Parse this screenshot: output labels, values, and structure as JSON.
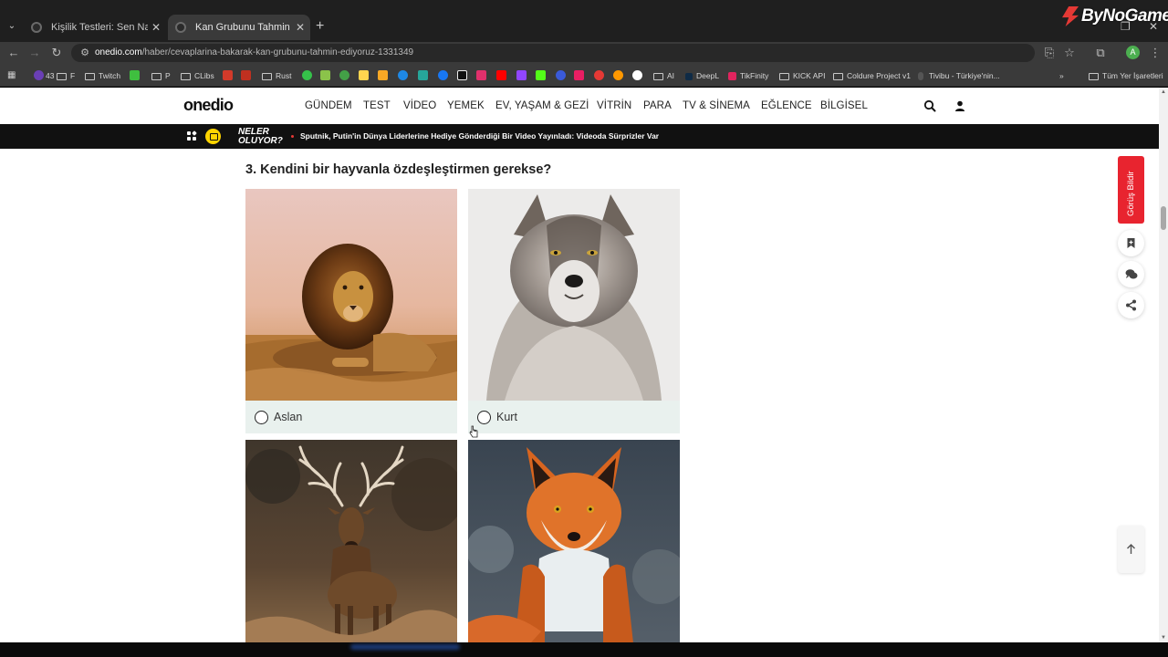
{
  "browser": {
    "tabs": [
      {
        "title": "Kişilik Testleri: Sen Nasıl Birisin?",
        "active": false
      },
      {
        "title": "Kan Grubunu Tahmin Edebilecek",
        "active": true
      }
    ],
    "url_domain": "onedio.com",
    "url_path": "/haber/cevaplarina-bakarak-kan-grubunu-tahmin-ediyoruz-1331349",
    "profile_initial": "A",
    "overlay_brand": "ByNoGame",
    "bookmarks": [
      {
        "label": "43",
        "icon": "badge"
      },
      {
        "label": "F",
        "icon": "folder"
      },
      {
        "label": "Twitch",
        "icon": "folder"
      },
      {
        "label": "P",
        "icon": "folder"
      },
      {
        "label": "CLibs",
        "icon": "folder"
      },
      {
        "label": "Rust",
        "icon": "folder"
      },
      {
        "label": "AI",
        "icon": "folder"
      },
      {
        "label": "DeepL",
        "icon": "deepl"
      },
      {
        "label": "TikFinity",
        "icon": "tikfinity"
      },
      {
        "label": "KICK API",
        "icon": "folder"
      },
      {
        "label": "Coldure Project v1",
        "icon": "folder"
      },
      {
        "label": "Tivibu - Türkiye'nin...",
        "icon": "tivibu"
      },
      {
        "label": "Tüm Yer İşaretleri",
        "icon": "folder"
      }
    ]
  },
  "site": {
    "logo": "onedio",
    "nav": [
      "GÜNDEM",
      "TEST",
      "VİDEO",
      "YEMEK",
      "EV, YAŞAM & GEZİ",
      "VİTRİN",
      "PARA",
      "TV & SİNEMA",
      "EĞLENCE",
      "BİLGİSEL"
    ],
    "ticker_label": "NELER OLUYOR?",
    "ticker_text": "Sputnik, Putin'in Dünya Liderlerine Hediye Gönderdiği Bir Video Yayınladı: Videoda Sürprizler Var"
  },
  "quiz": {
    "question": "3. Kendini bir hayvanla özdeşleştirmen gerekse?",
    "options": [
      {
        "label": "Aslan",
        "image": "lion"
      },
      {
        "label": "Kurt",
        "image": "wolf"
      },
      {
        "label": "",
        "image": "deer"
      },
      {
        "label": "",
        "image": "fox"
      }
    ]
  },
  "side": {
    "feedback_label": "Görüş Bildir",
    "icons": [
      "bookmark-icon",
      "comments-icon",
      "share-icon",
      "arrow-up-icon"
    ]
  }
}
